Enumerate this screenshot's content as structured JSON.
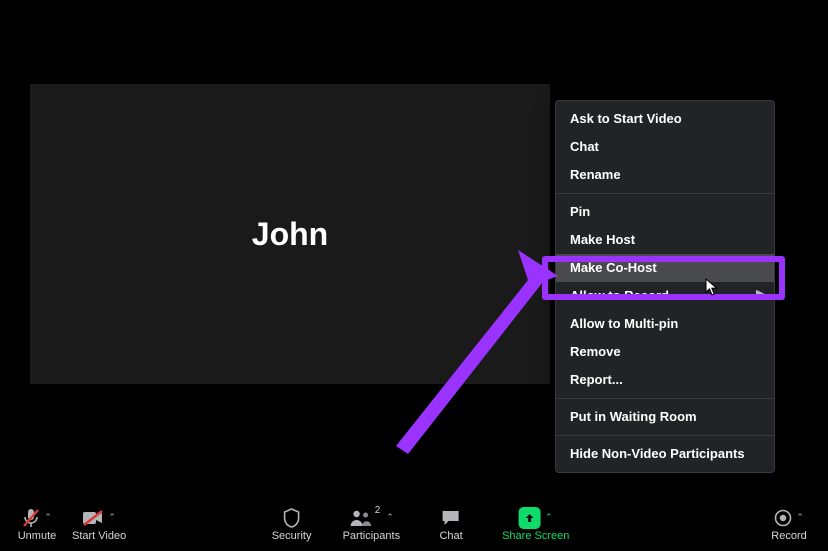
{
  "participant": {
    "name": "John"
  },
  "context_menu": {
    "items": [
      {
        "label": "Ask to Start Video"
      },
      {
        "label": "Chat"
      },
      {
        "label": "Rename"
      }
    ],
    "items2": [
      {
        "label": "Pin"
      },
      {
        "label": "Make Host"
      },
      {
        "label": "Make Co-Host"
      },
      {
        "label": "Allow to Record"
      },
      {
        "label": "Allow to Multi-pin"
      },
      {
        "label": "Remove"
      },
      {
        "label": "Report..."
      }
    ],
    "items3": [
      {
        "label": "Put in Waiting Room"
      }
    ],
    "items4": [
      {
        "label": "Hide Non-Video Participants"
      }
    ]
  },
  "toolbar": {
    "unmute": "Unmute",
    "start_video": "Start Video",
    "security": "Security",
    "participants": "Participants",
    "participants_count": "2",
    "chat": "Chat",
    "share_screen": "Share Screen",
    "record": "Record"
  }
}
